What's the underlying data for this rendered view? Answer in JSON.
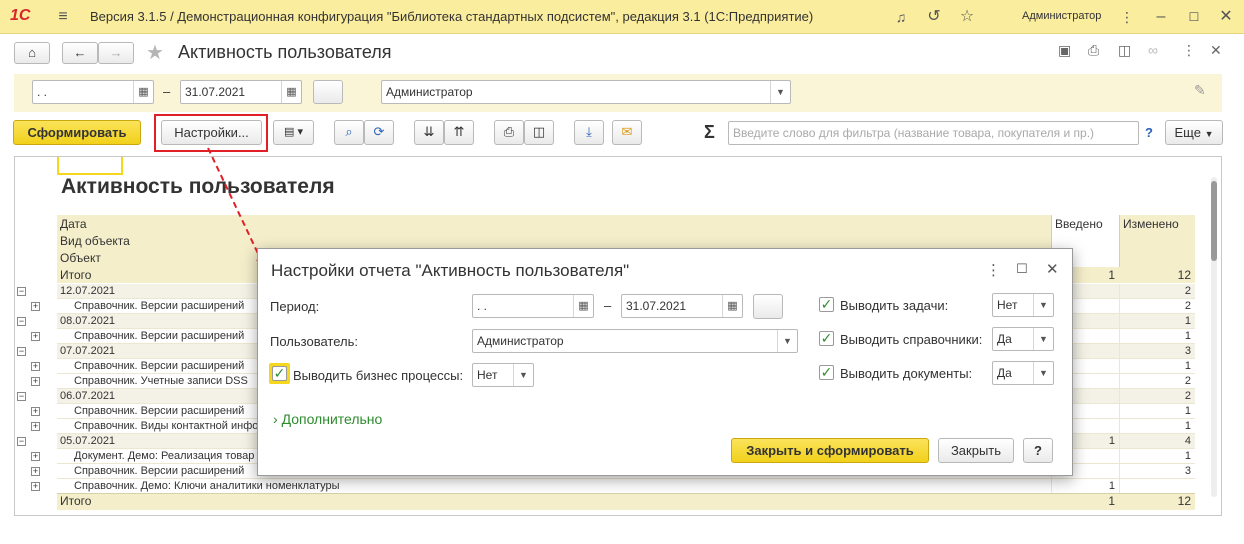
{
  "window": {
    "title": "Версия 3.1.5 / Демонстрационная конфигурация \"Библиотека стандартных подсистем\", редакция 3.1  (1С:Предприятие)",
    "user": "Администратор",
    "logo": "1С"
  },
  "form": {
    "title": "Активность пользователя",
    "period_from": "  .  .",
    "period_dash": "–",
    "period_to": "31.07.2021",
    "user_value": "Администратор",
    "generate_button": "Сформировать",
    "settings_button": "Настройки...",
    "more_button": "Еще",
    "filter_placeholder": "Введите слово для фильтра (название товара, покупателя и пр.)",
    "help_mark": "?",
    "sum_sign": "Σ"
  },
  "report": {
    "title": "Активность пользователя",
    "header_rows": [
      "Дата",
      "Вид объекта",
      "Объект",
      "Итого"
    ],
    "col_entered": "Введено",
    "col_changed": "Изменено",
    "total_label": "Итого",
    "header_total_entered": "1",
    "header_total_changed": "12",
    "rows": [
      {
        "level": 0,
        "text": "12.07.2021",
        "entered": "",
        "changed": "2"
      },
      {
        "level": 1,
        "text": "Справочник. Версии расширений",
        "entered": "",
        "changed": "2"
      },
      {
        "level": 0,
        "text": "08.07.2021",
        "entered": "",
        "changed": "1"
      },
      {
        "level": 1,
        "text": "Справочник. Версии расширений",
        "entered": "",
        "changed": "1"
      },
      {
        "level": 0,
        "text": "07.07.2021",
        "entered": "",
        "changed": "3"
      },
      {
        "level": 1,
        "text": "Справочник. Версии расширений",
        "entered": "",
        "changed": "1"
      },
      {
        "level": 1,
        "text": "Справочник. Учетные записи DSS",
        "entered": "",
        "changed": "2"
      },
      {
        "level": 0,
        "text": "06.07.2021",
        "entered": "",
        "changed": "2"
      },
      {
        "level": 1,
        "text": "Справочник. Версии расширений",
        "entered": "",
        "changed": "1"
      },
      {
        "level": 1,
        "text": "Справочник. Виды контактной инфо",
        "entered": "",
        "changed": "1"
      },
      {
        "level": 0,
        "text": "05.07.2021",
        "entered": "1",
        "changed": "4"
      },
      {
        "level": 1,
        "text": "Документ. Демо: Реализация товар",
        "entered": "",
        "changed": "1"
      },
      {
        "level": 1,
        "text": "Справочник. Версии расширений",
        "entered": "",
        "changed": "3"
      },
      {
        "level": 1,
        "text": "Справочник. Демо: Ключи аналитики номенклатуры",
        "entered": "1",
        "changed": ""
      }
    ],
    "footer_entered": "1",
    "footer_changed": "12"
  },
  "dialog": {
    "title": "Настройки отчета \"Активность пользователя\"",
    "period_label": "Период:",
    "period_from": "  .  .",
    "period_dash": "–",
    "period_to": "31.07.2021",
    "user_label": "Пользователь:",
    "user_value": "Администратор",
    "bp_label": "Выводить бизнес процессы:",
    "bp_value": "Нет",
    "tasks_label": "Выводить задачи:",
    "tasks_value": "Нет",
    "catalogs_label": "Выводить справочники:",
    "catalogs_value": "Да",
    "docs_label": "Выводить документы:",
    "docs_value": "Да",
    "more_link": "Дополнительно",
    "close_generate_button": "Закрыть и сформировать",
    "close_button": "Закрыть",
    "help_button": "?"
  },
  "colors": {
    "accent_yellow": "#f5d81e",
    "titlebar_bg": "#fbed9e",
    "header_band": "#f4eecb",
    "highlight_red": "#e01f26",
    "green": "#2e8b2e"
  }
}
